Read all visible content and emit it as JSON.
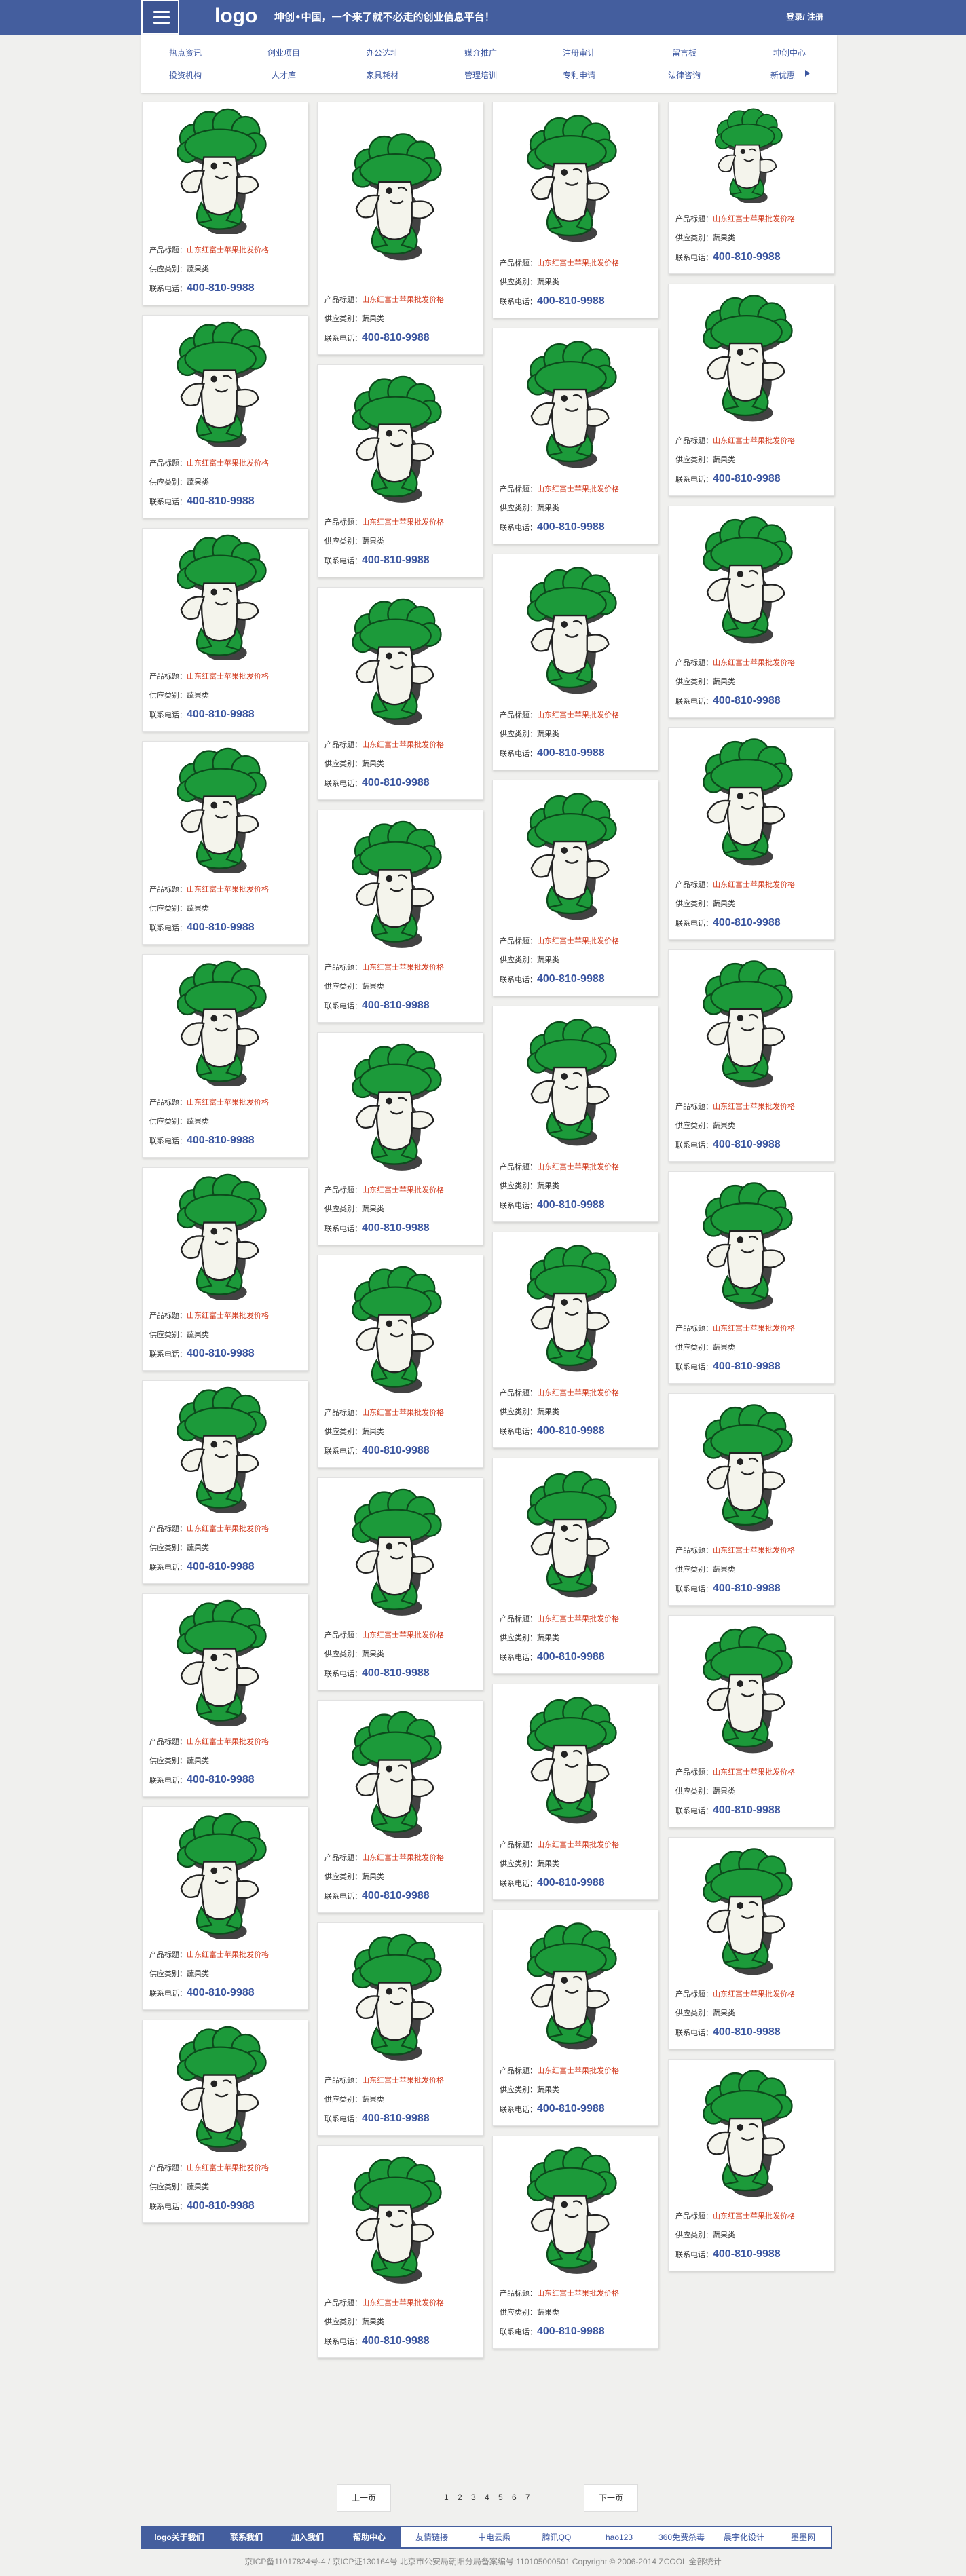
{
  "header": {
    "logo": "logo",
    "slogan": "坤创•中国，一个来了就不必走的创业信息平台！",
    "login": "登录/ 注册"
  },
  "nav": {
    "row1": [
      "热点资讯",
      "创业项目",
      "办公选址",
      "媒介推广",
      "注册审计",
      "留言板",
      "坤创中心"
    ],
    "row2": [
      "投资机构",
      "人才库",
      "家具耗材",
      "管理培训",
      "专利申请",
      "法律咨询",
      "新优惠"
    ]
  },
  "card": {
    "title_label": "产品标题：",
    "title_value": "山东红富士苹果批发价格",
    "type_label": "供应类别：",
    "type_value": "蔬果类",
    "phone_label": "联系电话：",
    "phone_value": "400-810-9988"
  },
  "columns": [
    {
      "count": 10,
      "image_heights": [
        186,
        186,
        186,
        186,
        186,
        186,
        186,
        186,
        186,
        186
      ]
    },
    {
      "count": 10,
      "image_heights": [
        259,
        200,
        200,
        200,
        200,
        200,
        200,
        200,
        200,
        200
      ]
    },
    {
      "count": 10,
      "image_heights": [
        205,
        205,
        205,
        205,
        205,
        205,
        205,
        205,
        205,
        200
      ]
    },
    {
      "count": 10,
      "image_heights": [
        140,
        199,
        199,
        199,
        199,
        199,
        199,
        199,
        199,
        199
      ]
    }
  ],
  "pager": {
    "prev": "上一页",
    "next": "下一页",
    "pages": [
      "1",
      "2",
      "3",
      "4",
      "5",
      "6",
      "7"
    ]
  },
  "footer": {
    "dark_links": [
      "logo关于我们",
      "联系我们",
      "加入我们",
      "帮助中心"
    ],
    "light_links": [
      "友情链接",
      "中电云乘",
      "腾讯QQ",
      "hao123",
      "360免费杀毒",
      "晨宇化设计",
      "墨墨网"
    ],
    "copyright": "京ICP备11017824号-4 / 京ICP证130164号 北京市公安局朝阳分局备案编号:110105000501 Copyright © 2006-2014 ZCOOL 全部统计"
  },
  "colors": {
    "header": "#445e9e",
    "link": "#3b56a0",
    "title_red": "#d23a1e",
    "mascot_green": "#1c9a3a"
  },
  "icons": {
    "menu": "hamburger-menu-icon",
    "nav_arrow": "chevron-right-icon",
    "card_image": "broccoli-mascot"
  }
}
